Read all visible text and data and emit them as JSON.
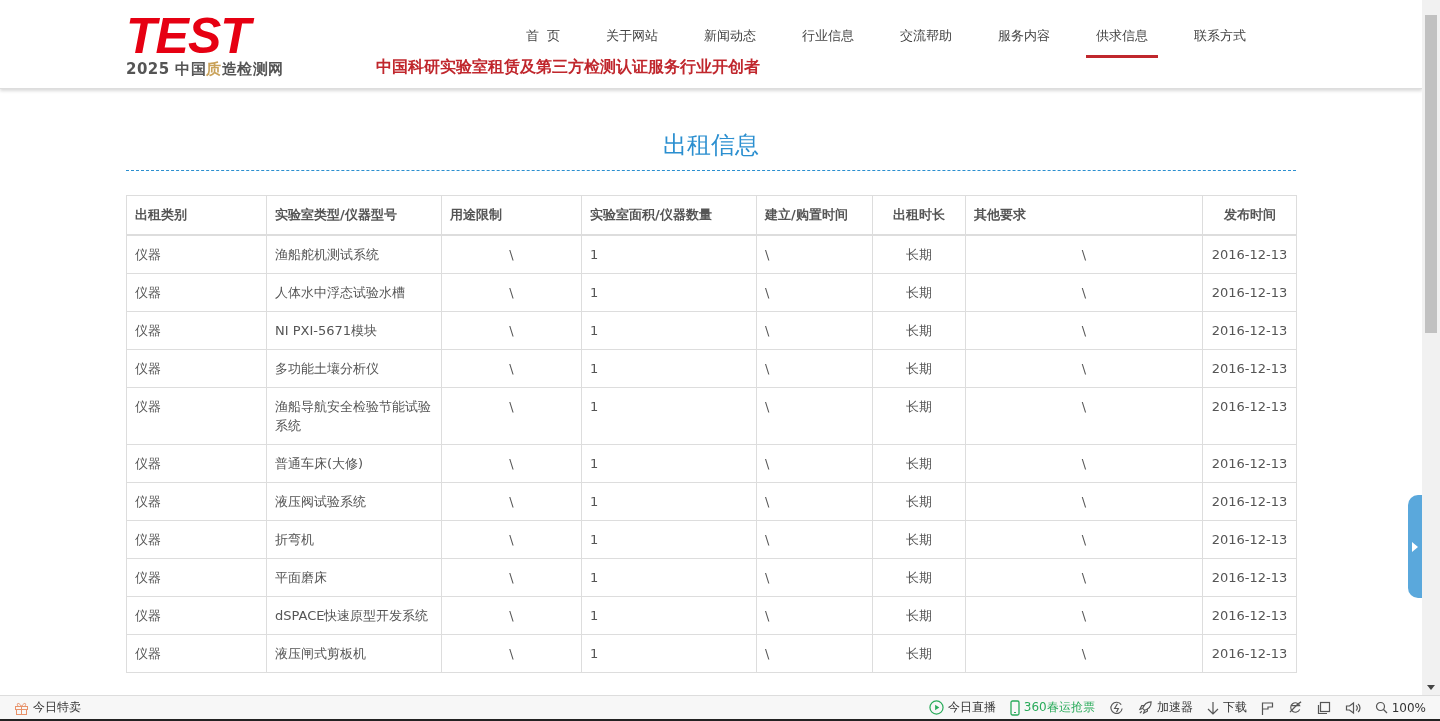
{
  "header": {
    "logo": {
      "wordmark": "TEST",
      "subtitle": [
        {
          "text": "2025 中国",
          "highlight": false
        },
        {
          "text": "质",
          "highlight": true
        },
        {
          "text": "造检测网",
          "highlight": false
        }
      ]
    },
    "slogan": "中国科研实验室租赁及第三方检测认证服务行业开创者",
    "nav": [
      {
        "label": "首  页",
        "selected": false
      },
      {
        "label": "关于网站",
        "selected": false
      },
      {
        "label": "新闻动态",
        "selected": false
      },
      {
        "label": "行业信息",
        "selected": false
      },
      {
        "label": "交流帮助",
        "selected": false
      },
      {
        "label": "服务内容",
        "selected": false
      },
      {
        "label": "供求信息",
        "selected": true
      },
      {
        "label": "联系方式",
        "selected": false
      }
    ]
  },
  "page_title": "出租信息",
  "table": {
    "columns": [
      "出租类别",
      "实验室类型/仪器型号",
      "用途限制",
      "实验室面积/仪器数量",
      "建立/购置时间",
      "出租时长",
      "其他要求",
      "发布时间"
    ],
    "rows": [
      [
        "仪器",
        "渔船舵机测试系统",
        "\\",
        "1",
        "\\",
        "长期",
        "\\",
        "2016-12-13"
      ],
      [
        "仪器",
        "人体水中浮态试验水槽",
        "\\",
        "1",
        "\\",
        "长期",
        "\\",
        "2016-12-13"
      ],
      [
        "仪器",
        "NI PXI-5671模块",
        "\\",
        "1",
        "\\",
        "长期",
        "\\",
        "2016-12-13"
      ],
      [
        "仪器",
        "多功能土壤分析仪",
        "\\",
        "1",
        "\\",
        "长期",
        "\\",
        "2016-12-13"
      ],
      [
        "仪器",
        "渔船导航安全检验节能试验系统",
        "\\",
        "1",
        "\\",
        "长期",
        "\\",
        "2016-12-13"
      ],
      [
        "仪器",
        "普通车床(大修)",
        "\\",
        "1",
        "\\",
        "长期",
        "\\",
        "2016-12-13"
      ],
      [
        "仪器",
        "液压阀试验系统",
        "\\",
        "1",
        "\\",
        "长期",
        "\\",
        "2016-12-13"
      ],
      [
        "仪器",
        "折弯机",
        "\\",
        "1",
        "\\",
        "长期",
        "\\",
        "2016-12-13"
      ],
      [
        "仪器",
        "平面磨床",
        "\\",
        "1",
        "\\",
        "长期",
        "\\",
        "2016-12-13"
      ],
      [
        "仪器",
        "dSPACE快速原型开发系统",
        "\\",
        "1",
        "\\",
        "长期",
        "\\",
        "2016-12-13"
      ],
      [
        "仪器",
        "液压闸式剪板机",
        "\\",
        "1",
        "\\",
        "长期",
        "\\",
        "2016-12-13"
      ]
    ]
  },
  "status_bar": {
    "left": [
      {
        "kind": "gift",
        "label": "今日特卖"
      }
    ],
    "right": [
      {
        "kind": "play",
        "label": "今日直播"
      },
      {
        "kind": "phone",
        "label": "360春运抢票"
      },
      {
        "kind": "swirl"
      },
      {
        "kind": "rocket",
        "label": "加速器"
      },
      {
        "kind": "download",
        "label": "下载"
      },
      {
        "kind": "flag"
      },
      {
        "kind": "ie"
      },
      {
        "kind": "window"
      },
      {
        "kind": "speaker"
      },
      {
        "kind": "zoom",
        "label": "100%"
      }
    ]
  }
}
